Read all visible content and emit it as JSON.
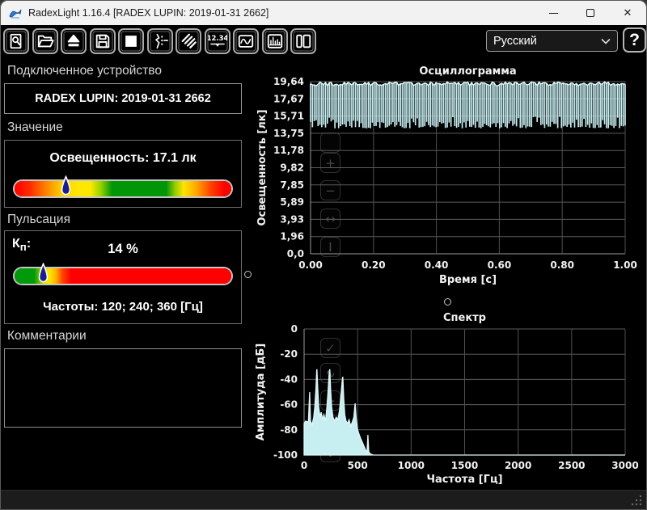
{
  "window": {
    "title": "RadexLight 1.16.4 [RADEX LUPIN: 2019-01-31 2662]",
    "controls": {
      "close_glyph": "✕"
    }
  },
  "toolbar": {
    "buttons": [
      {
        "name": "find-device",
        "icon": "magnifier-document-icon"
      },
      {
        "name": "open-file",
        "icon": "open-folder-icon"
      },
      {
        "name": "eject-device",
        "icon": "eject-icon"
      },
      {
        "name": "save-file",
        "icon": "floppy-disk-icon"
      },
      {
        "name": "stop-measurement",
        "icon": "stop-square-icon"
      },
      {
        "name": "signal-settings",
        "icon": "waveform-settings-icon"
      },
      {
        "name": "sweep-settings",
        "icon": "hatch-lines-icon"
      },
      {
        "name": "numeric-view",
        "icon": "numeric-display-icon"
      },
      {
        "name": "oscillogram-view",
        "icon": "wave-box-icon"
      },
      {
        "name": "spectrum-view",
        "icon": "bars-box-icon"
      },
      {
        "name": "layout-view",
        "icon": "panels-icon"
      }
    ],
    "numeric_icon_text": "12.34",
    "language_select": {
      "value": "Русский"
    },
    "help_label": "?"
  },
  "device_panel": {
    "header": "Подключенное устройство",
    "device_name": "RADEX LUPIN: 2019-01-31 2662"
  },
  "value_panel": {
    "header": "Значение",
    "reading_label": "Освещенность: 17.1 лк",
    "marker_percent": 23.5
  },
  "pulsation_panel": {
    "header": "Пульсация",
    "kp_label": "К",
    "kp_sub": "п",
    "kp_colon": ":",
    "kp_value": "14 %",
    "marker_percent": 13,
    "frequencies_label": "Частоты: 120; 240; 360 [Гц]"
  },
  "comments_panel": {
    "header": "Комментарии",
    "text": ""
  },
  "chart_data": [
    {
      "type": "area",
      "name": "oscillogram",
      "title": "Осциллограмма",
      "xlabel": "Время [с]",
      "ylabel": "Освещенность [лк]",
      "x_ticks": [
        "0.00",
        "0.20",
        "0.40",
        "0.60",
        "0.80",
        "1.00"
      ],
      "xlim": [
        0,
        1
      ],
      "y_ticks": [
        "19,64",
        "17,67",
        "15,71",
        "13,75",
        "11,78",
        "9,82",
        "7,85",
        "5,89",
        "3,93",
        "1,96",
        "0,0"
      ],
      "ylim": [
        0,
        19.64
      ],
      "grid": true,
      "description": "100 Hz light-flicker waveform filling full 1 s span, oscillating between about 14.3 and 19.6 lx (mean 17.1 lx)",
      "waveform": {
        "top_mean": 19.62,
        "top_jitter": 0.45,
        "bottom_min": 14.32,
        "bottom_jitter": 1.5,
        "columns": 168,
        "seed": 987654321
      },
      "color": "#c7eef1"
    },
    {
      "type": "area",
      "name": "spectrum",
      "title": "Спектр",
      "xlabel": "Частота [Гц]",
      "ylabel": "Амплитуда [дБ]",
      "x_ticks": [
        "0",
        "500",
        "1000",
        "1500",
        "2000",
        "2500",
        "3000"
      ],
      "xlim": [
        0,
        3000
      ],
      "y_ticks": [
        "0",
        "-20",
        "-40",
        "-60",
        "-80",
        "-100"
      ],
      "ylim": [
        -100,
        0
      ],
      "grid": true,
      "description": "FFT spectrum: main peaks near 120, 240 and 360 Hz, floor decays to -100 dB above ~650 Hz",
      "points": [
        [
          0,
          -75
        ],
        [
          15,
          -73
        ],
        [
          40,
          -74
        ],
        [
          52,
          -50
        ],
        [
          60,
          -73
        ],
        [
          75,
          -76
        ],
        [
          90,
          -70
        ],
        [
          100,
          -62
        ],
        [
          110,
          -48
        ],
        [
          118,
          -33
        ],
        [
          120,
          -32
        ],
        [
          127,
          -46
        ],
        [
          137,
          -62
        ],
        [
          150,
          -70
        ],
        [
          160,
          -66
        ],
        [
          172,
          -72
        ],
        [
          185,
          -68
        ],
        [
          200,
          -73
        ],
        [
          213,
          -62
        ],
        [
          224,
          -50
        ],
        [
          235,
          -34
        ],
        [
          240,
          -32
        ],
        [
          248,
          -48
        ],
        [
          258,
          -62
        ],
        [
          270,
          -70
        ],
        [
          285,
          -73
        ],
        [
          300,
          -70
        ],
        [
          315,
          -72
        ],
        [
          330,
          -65
        ],
        [
          345,
          -52
        ],
        [
          358,
          -39
        ],
        [
          362,
          -38
        ],
        [
          370,
          -55
        ],
        [
          380,
          -68
        ],
        [
          392,
          -73
        ],
        [
          405,
          -75
        ],
        [
          420,
          -72
        ],
        [
          435,
          -77
        ],
        [
          450,
          -74
        ],
        [
          465,
          -70
        ],
        [
          477,
          -59
        ],
        [
          488,
          -72
        ],
        [
          500,
          -80
        ],
        [
          515,
          -84
        ],
        [
          530,
          -87
        ],
        [
          545,
          -90
        ],
        [
          560,
          -93
        ],
        [
          575,
          -96
        ],
        [
          588,
          -98
        ],
        [
          596,
          -84
        ],
        [
          604,
          -97
        ],
        [
          615,
          -99
        ],
        [
          645,
          -100
        ],
        [
          3000,
          -100
        ]
      ],
      "color": "#c7eef1"
    }
  ],
  "chart_controls": {
    "oscillogram": [
      "blank",
      "plus",
      "minus",
      "fit-x",
      "ibeam"
    ],
    "spectrum": [
      "check",
      "wave",
      "plus",
      "minus",
      "fit-y"
    ]
  }
}
